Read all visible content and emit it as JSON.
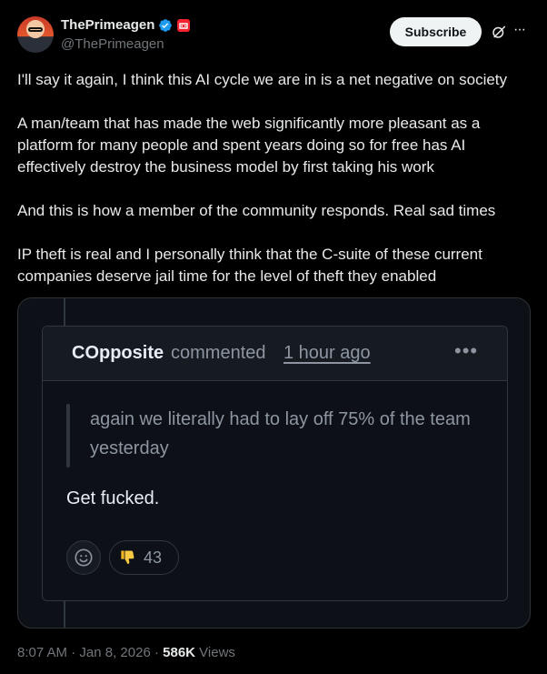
{
  "author": {
    "name": "ThePrimeagen",
    "handle": "@ThePrimeagen"
  },
  "actions": {
    "subscribe_label": "Subscribe",
    "grok_icon": "grok-icon",
    "more_icon": "more-icon"
  },
  "tweet": {
    "paragraphs": [
      "I'll say it again, I think this AI cycle we are in is a net negative on society",
      "A man/team that has made the web significantly more pleasant as a platform for many people and spent years doing so for free has AI effectively destroy the business model by first taking his work",
      "And this is how a member of the community responds. Real sad times",
      "IP theft is real and I personally think that the C-suite of these current companies deserve jail time for the level of theft they enabled"
    ]
  },
  "embedded_comment": {
    "author": "COpposite",
    "action": "commented",
    "time": "1 hour ago",
    "quote": "again we literally had to lay off 75% of the team yesterday",
    "body": "Get fucked.",
    "reaction_count": "43",
    "reaction_emoji": "👎",
    "icons": [
      "smiley-icon",
      "thumbs-down-icon",
      "kebab-menu-icon"
    ]
  },
  "meta": {
    "time": "8:07 AM",
    "date": "Jan 8, 2026",
    "views_count": "586K",
    "views_label": "Views"
  },
  "colors": {
    "background": "#000000",
    "text": "#e7e9ea",
    "muted": "#71767b",
    "verified": "#1d9bf0",
    "badge_red": "#f4212e",
    "github_bg": "#0d1117",
    "github_header": "#161b22"
  }
}
